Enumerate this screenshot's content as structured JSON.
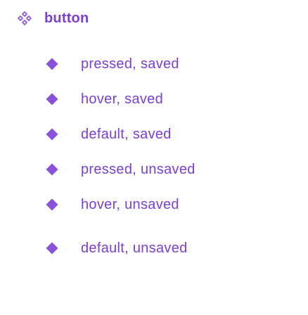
{
  "component": {
    "label": "button",
    "icon": "component-set-icon"
  },
  "variants": [
    {
      "label": "pressed, saved",
      "icon": "variant-diamond-icon"
    },
    {
      "label": "hover, saved",
      "icon": "variant-diamond-icon"
    },
    {
      "label": "default, saved",
      "icon": "variant-diamond-icon"
    },
    {
      "label": "pressed, unsaved",
      "icon": "variant-diamond-icon"
    },
    {
      "label": "hover, unsaved",
      "icon": "variant-diamond-icon"
    },
    {
      "label": "default, unsaved",
      "icon": "variant-diamond-icon"
    }
  ],
  "colors": {
    "text": "#7b3fd2",
    "icon": "#8a52da"
  }
}
